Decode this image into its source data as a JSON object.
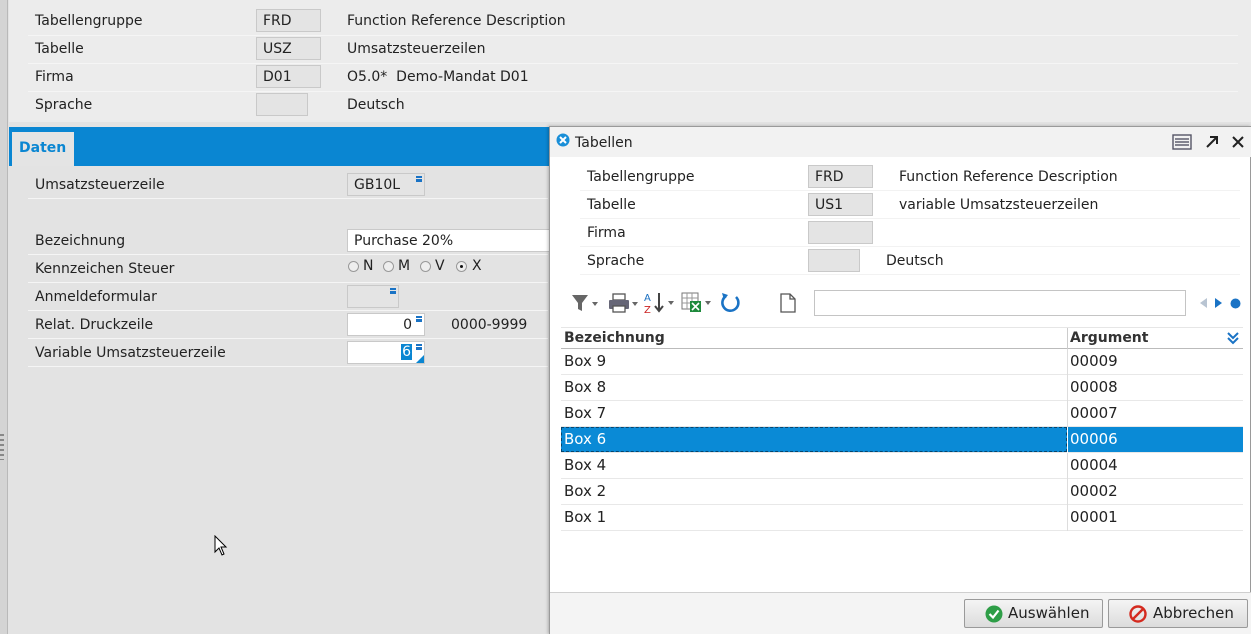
{
  "header": {
    "fields": [
      {
        "label": "Tabellengruppe",
        "value": "FRD",
        "desc": "Function Reference Description"
      },
      {
        "label": "Tabelle",
        "value": "USZ",
        "desc": "Umsatzsteuerzeilen"
      },
      {
        "label": "Firma",
        "value": "D01",
        "desc": "O5.0*  Demo-Mandat D01"
      },
      {
        "label": "Sprache",
        "value": "",
        "desc": "Deutsch"
      }
    ]
  },
  "tabs": [
    {
      "label": "Daten"
    }
  ],
  "form": {
    "umsatzsteuerzeile": {
      "label": "Umsatzsteuerzeile",
      "value": "GB10L"
    },
    "bezeichnung": {
      "label": "Bezeichnung",
      "value": "Purchase 20%"
    },
    "kennzeichen": {
      "label": "Kennzeichen Steuer",
      "options": [
        "N",
        "M",
        "V",
        "X"
      ],
      "selected": "X"
    },
    "anmeldeformular": {
      "label": "Anmeldeformular",
      "value": ""
    },
    "druckzeile": {
      "label": "Relat. Druckzeile",
      "value": "0",
      "range": "0000-9999"
    },
    "variable": {
      "label": "Variable Umsatzsteuerzeile",
      "value": "6"
    }
  },
  "dialog": {
    "title": "Tabellen",
    "fields": [
      {
        "label": "Tabellengruppe",
        "value": "FRD",
        "desc": "Function Reference Description"
      },
      {
        "label": "Tabelle",
        "value": "US1",
        "desc": "variable Umsatzsteuerzeilen"
      },
      {
        "label": "Firma",
        "value": "",
        "desc": ""
      },
      {
        "label": "Sprache",
        "value": "",
        "desc": "Deutsch"
      }
    ],
    "search_value": "",
    "columns": [
      "Bezeichnung",
      "Argument"
    ],
    "rows": [
      {
        "bezeichnung": "Box 9",
        "argument": "00009"
      },
      {
        "bezeichnung": "Box 8",
        "argument": "00008"
      },
      {
        "bezeichnung": "Box 7",
        "argument": "00007"
      },
      {
        "bezeichnung": "Box 6",
        "argument": "00006"
      },
      {
        "bezeichnung": "Box 4",
        "argument": "00004"
      },
      {
        "bezeichnung": "Box 2",
        "argument": "00002"
      },
      {
        "bezeichnung": "Box 1",
        "argument": "00001"
      }
    ],
    "selected_row": "Box 6",
    "buttons": {
      "select": "Auswählen",
      "cancel": "Abbrechen"
    }
  },
  "colors": {
    "accent": "#0a8ad6",
    "selection": "#0a8ad6",
    "tab_bar": "#0a86d2"
  }
}
